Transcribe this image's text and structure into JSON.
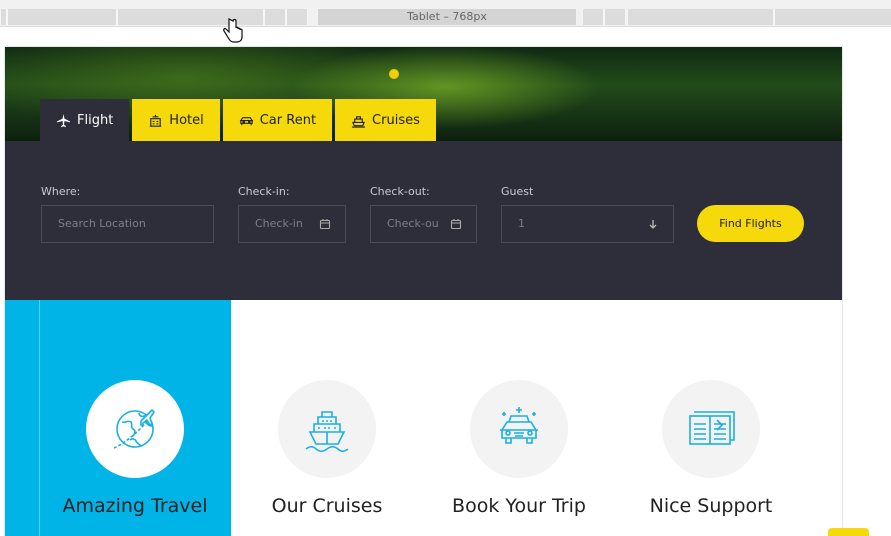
{
  "ruler": {
    "label": "Tablet – 768px"
  },
  "tabs": [
    {
      "label": "Flight",
      "icon": "plane-icon",
      "active": true
    },
    {
      "label": "Hotel",
      "icon": "hotel-icon",
      "active": false
    },
    {
      "label": "Car Rent",
      "icon": "car-icon",
      "active": false
    },
    {
      "label": "Cruises",
      "icon": "ship-icon",
      "active": false
    }
  ],
  "search": {
    "where": {
      "label": "Where:",
      "placeholder": "Search Location"
    },
    "checkin": {
      "label": "Check-in:",
      "placeholder": "Check-in"
    },
    "checkout": {
      "label": "Check-out:",
      "placeholder": "Check-ou"
    },
    "guest": {
      "label": "Guest",
      "value": "1"
    },
    "button": "Find Flights"
  },
  "features": [
    {
      "title": "Amazing Travel",
      "icon": "globe-plane-icon",
      "highlight": true
    },
    {
      "title": "Our Cruises",
      "icon": "cruise-ship-icon",
      "highlight": false
    },
    {
      "title": "Book Your Trip",
      "icon": "taxi-car-icon",
      "highlight": false
    },
    {
      "title": "Nice Support",
      "icon": "brochure-icon",
      "highlight": false
    }
  ],
  "colors": {
    "accent": "#f5d90b",
    "dark": "#2e2e3a",
    "blue": "#00b4e8",
    "icon": "#1ab0e0"
  }
}
